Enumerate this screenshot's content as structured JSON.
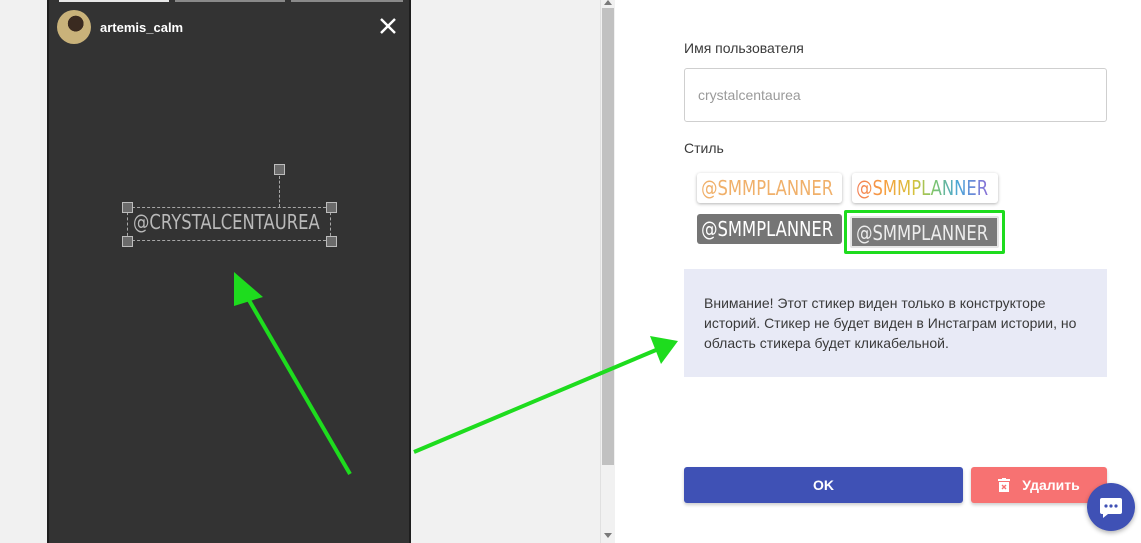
{
  "story": {
    "username": "artemis_calm",
    "sticker_text": "@CRYSTALCENTAUREA",
    "close_icon": "close-icon"
  },
  "form": {
    "username_label": "Имя пользователя",
    "username_placeholder": "crystalcentaurea",
    "style_label": "Стиль",
    "style_options": [
      "@SMMPLANNER",
      "@SMMPLANNER",
      "@SMMPLANNER",
      "@SMMPLANNER"
    ],
    "selected_style_index": 3,
    "notice": "Внимание! Этот стикер виден только в конструкторе историй. Стикер не будет виден в Инстаграм истории, но область стикера будет кликабельной.",
    "ok_label": "OK",
    "delete_label": "Удалить"
  },
  "colors": {
    "primary": "#3f51b5",
    "danger": "#f77272",
    "highlight": "#1edc1e",
    "notice_bg": "#e8eaf6"
  }
}
